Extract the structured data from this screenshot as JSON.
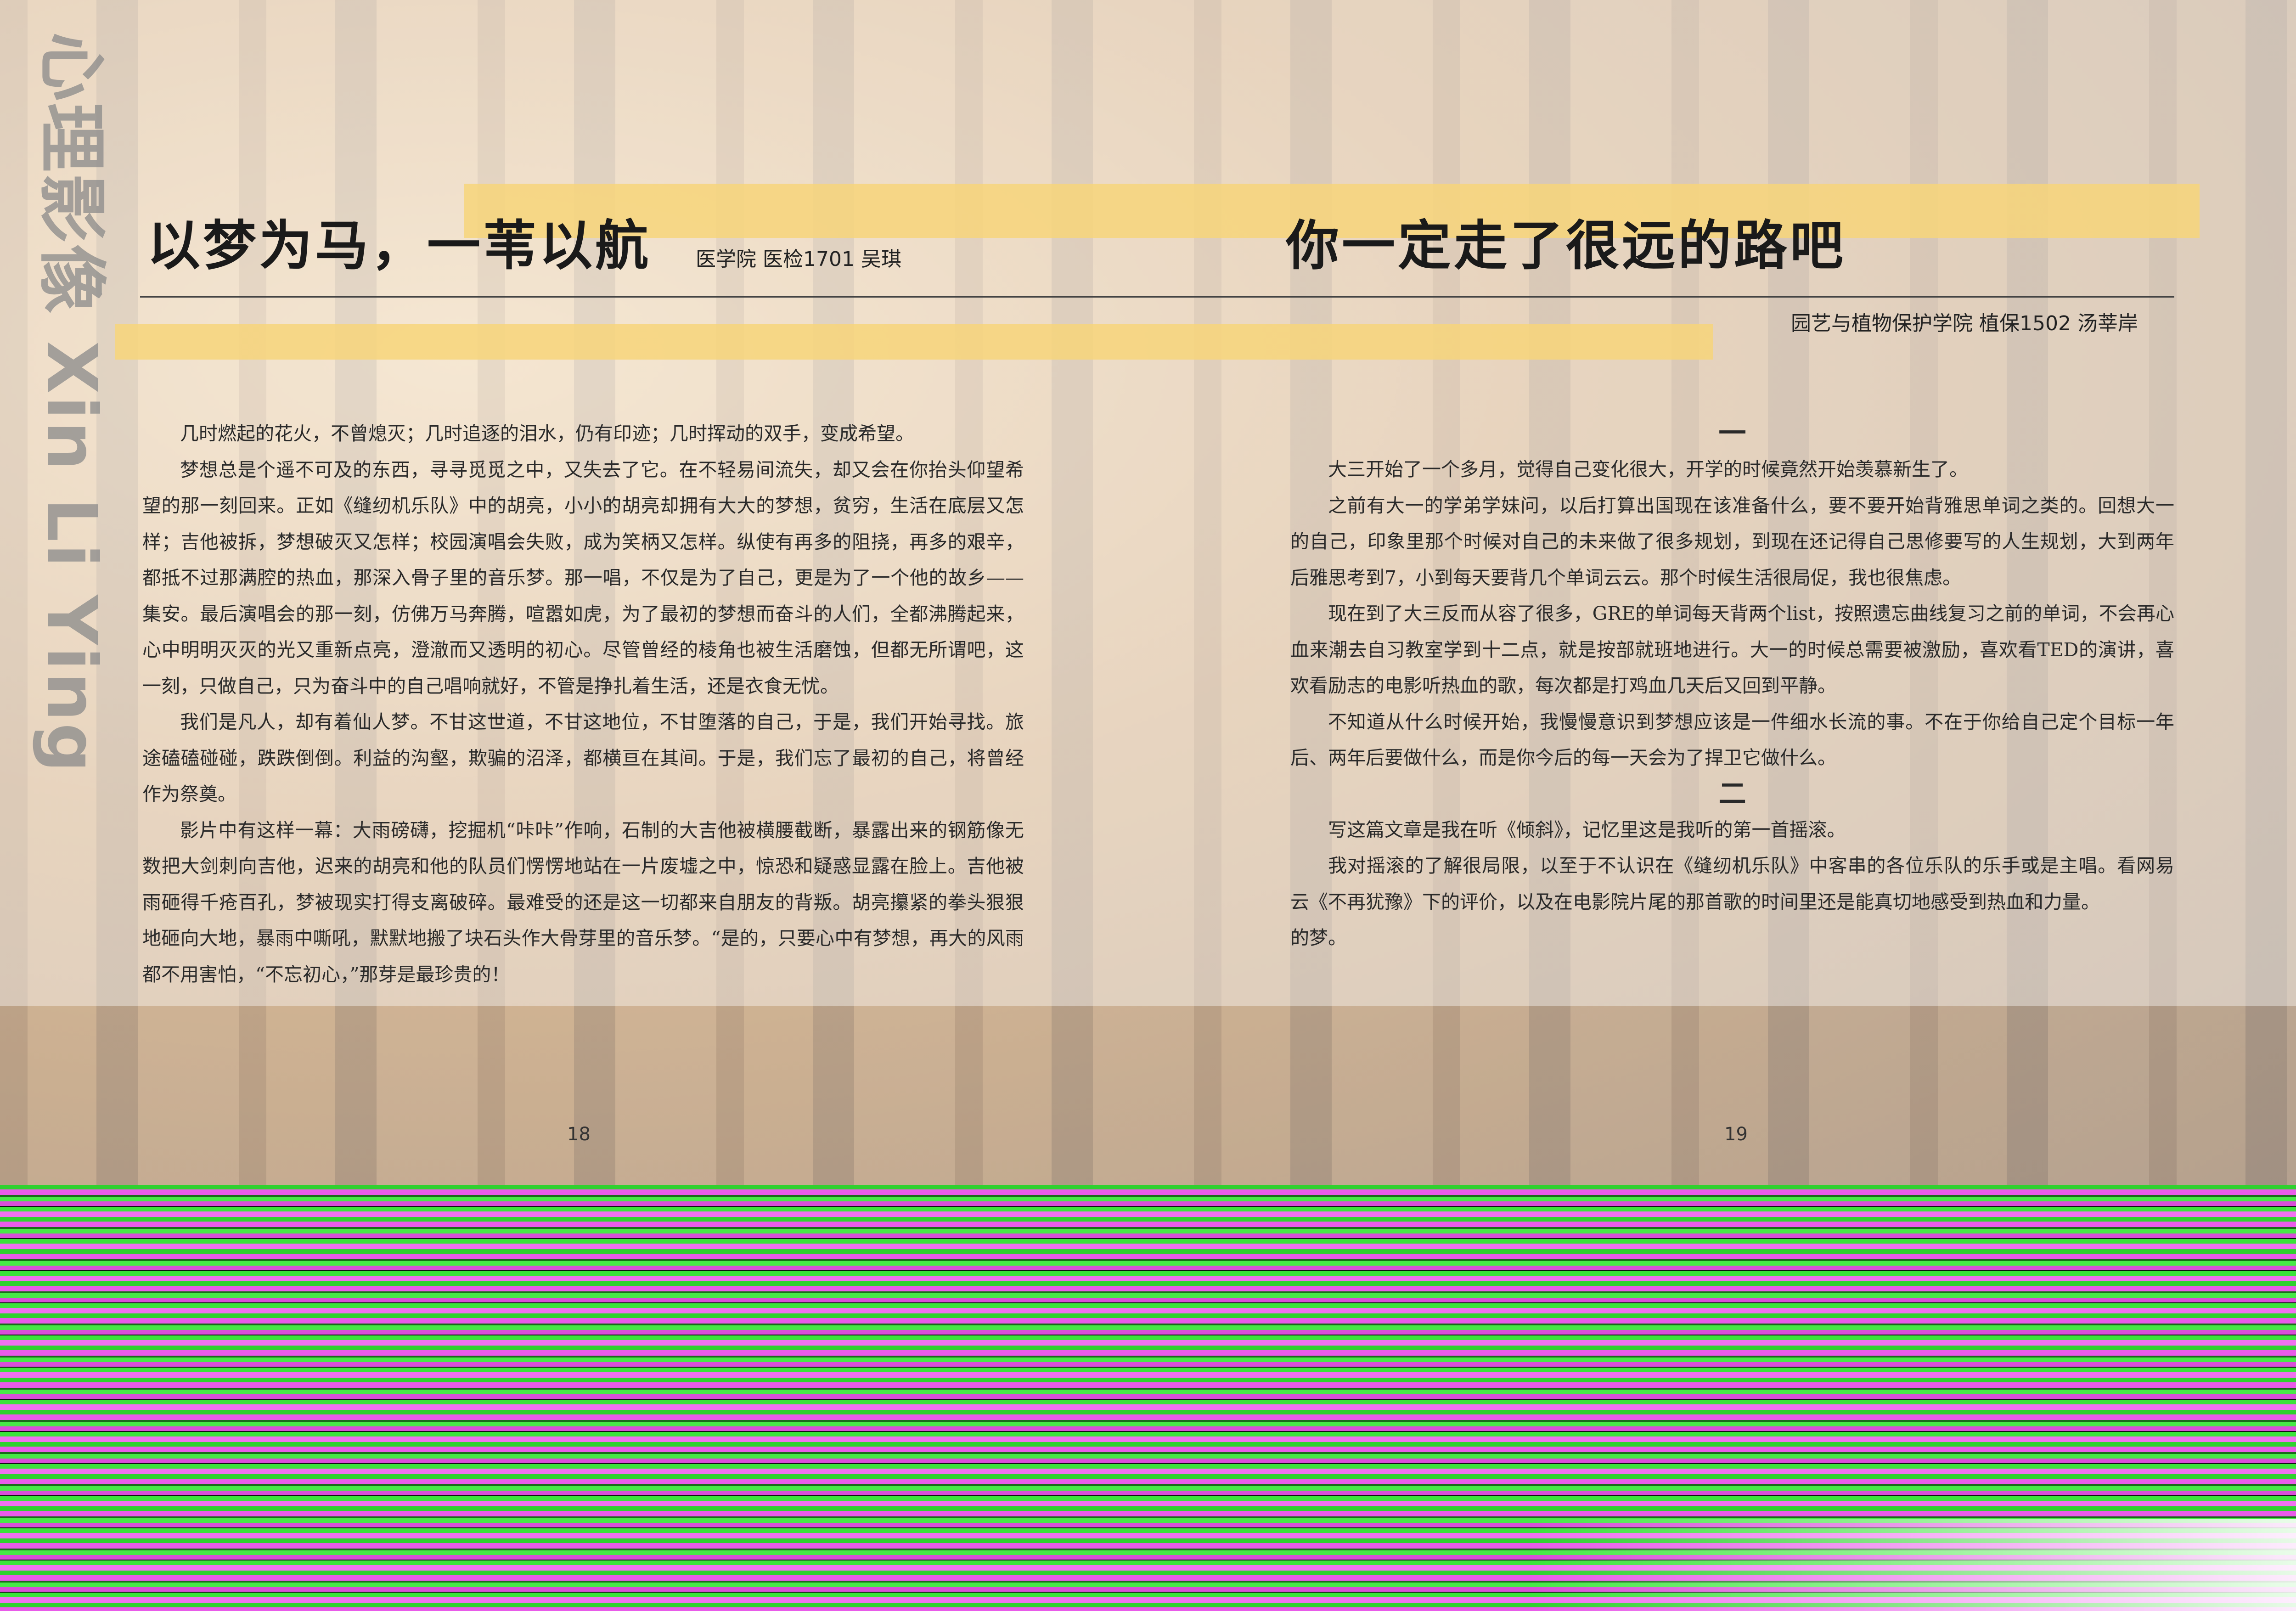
{
  "vertical_title": "心理影像 Xin Li Ying",
  "left": {
    "title": "以梦为马，一苇以航",
    "byline": "医学院  医检1701   吴琪",
    "paragraphs": [
      "几时燃起的花火，不曾熄灭；几时追逐的泪水，仍有印迹；几时挥动的双手，变成希望。",
      "梦想总是个遥不可及的东西，寻寻觅觅之中，又失去了它。在不轻易间流失，却又会在你抬头仰望希望的那一刻回来。正如《缝纫机乐队》中的胡亮，小小的胡亮却拥有大大的梦想，贫穷，生活在底层又怎样；吉他被拆，梦想破灭又怎样；校园演唱会失败，成为笑柄又怎样。纵使有再多的阻挠，再多的艰辛，都抵不过那满腔的热血，那深入骨子里的音乐梦。那一唱，不仅是为了自己，更是为了一个他的故乡——集安。最后演唱会的那一刻，仿佛万马奔腾，喧嚣如虎，为了最初的梦想而奋斗的人们，全都沸腾起来，心中明明灭灭的光又重新点亮，澄澈而又透明的初心。尽管曾经的棱角也被生活磨蚀，但都无所谓吧，这一刻，只做自己，只为奋斗中的自己唱响就好，不管是挣扎着生活，还是衣食无忧。",
      "我们是凡人，却有着仙人梦。不甘这世道，不甘这地位，不甘堕落的自己，于是，我们开始寻找。旅途磕磕碰碰，跌跌倒倒。利益的沟壑，欺骗的沼泽，都横亘在其间。于是，我们忘了最初的自己，将曾经作为祭奠。",
      "影片中有这样一幕：大雨磅礴，挖掘机“咔咔”作响，石制的大吉他被横腰截断，暴露出来的钢筋像无数把大剑刺向吉他，迟来的胡亮和他的队员们愣愣地站在一片废墟之中，惊恐和疑惑显露在脸上。吉他被雨砸得千疮百孔，梦被现实打得支离破碎。最难受的还是这一切都来自朋友的背叛。胡亮攥紧的拳头狠狠地砸向大地，暴雨中嘶吼，默默地搬了块石头作大骨芽里的音乐梦。“是的，只要心中有梦想，再大的风雨都不用害怕，“不忘初心，”那芽是最珍贵的！"
    ],
    "page_number": "18"
  },
  "right": {
    "title": "你一定走了很远的路吧",
    "byline": "园艺与植物保护学院    植保1502  汤莘岸",
    "sections": [
      {
        "heading": "一",
        "paragraphs": [
          "大三开始了一个多月，觉得自己变化很大，开学的时候竟然开始羡慕新生了。",
          "之前有大一的学弟学妹问，以后打算出国现在该准备什么，要不要开始背雅思单词之类的。回想大一的自己，印象里那个时候对自己的未来做了很多规划，到现在还记得自己思修要写的人生规划，大到两年后雅思考到7，小到每天要背几个单词云云。那个时候生活很局促，我也很焦虑。",
          "现在到了大三反而从容了很多，GRE的单词每天背两个list，按照遗忘曲线复习之前的单词，不会再心血来潮去自习教室学到十二点，就是按部就班地进行。大一的时候总需要被激励，喜欢看TED的演讲，喜欢看励志的电影听热血的歌，每次都是打鸡血几天后又回到平静。",
          "不知道从什么时候开始，我慢慢意识到梦想应该是一件细水长流的事。不在于你给自己定个目标一年后、两年后要做什么，而是你今后的每一天会为了捍卫它做什么。"
        ]
      },
      {
        "heading": "二",
        "paragraphs": [
          "写这篇文章是我在听《倾斜》，记忆里这是我听的第一首摇滚。",
          "我对摇滚的了解很局限，以至于不认识在《缝纫机乐队》中客串的各位乐队的乐手或是主唱。看网易云《不再犹豫》下的评价，以及在电影院片尾的那首歌的时间里还是能真切地感受到热血和力量。",
          "的梦。"
        ]
      }
    ],
    "page_number": "19"
  }
}
